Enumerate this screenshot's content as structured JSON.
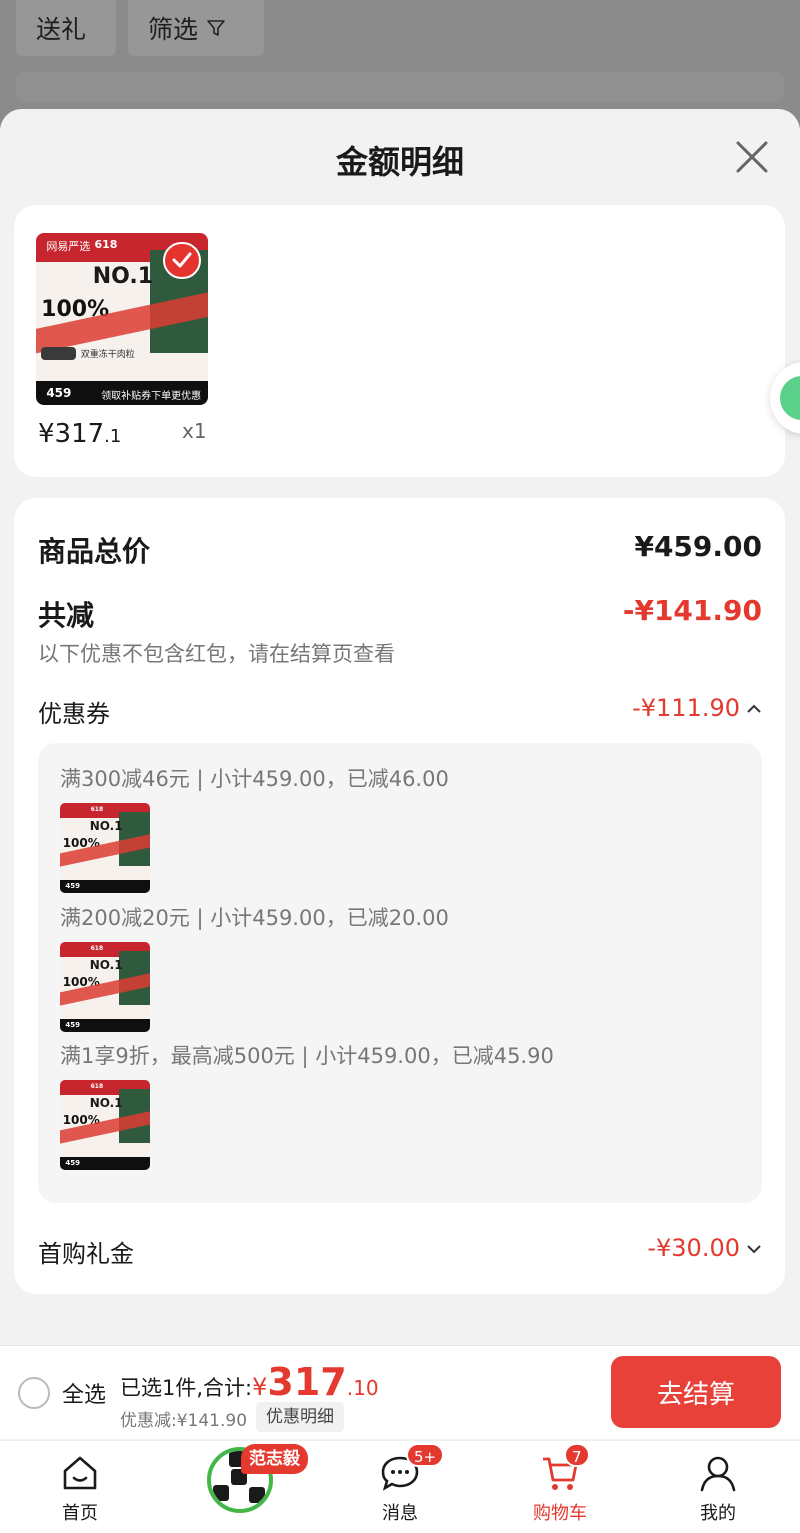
{
  "background": {
    "chip_gift": "送礼",
    "chip_filter": "筛选"
  },
  "sheet": {
    "title": "金额明细"
  },
  "product": {
    "image": {
      "brand": "网易严选",
      "promo_618": "618",
      "no1": "NO.1",
      "pct": "100%",
      "tag": "双重冻干肉粒",
      "price_tag": "459",
      "bottom_text": "领取补贴券下单更优惠"
    },
    "price_int": "¥317",
    "price_dec": ".1",
    "qty": "x1"
  },
  "summary": {
    "total_label": "商品总价",
    "total_value": "¥459.00",
    "minus_label": "共减",
    "minus_value": "-¥141.90",
    "note": "以下优惠不包含红包，请在结算页查看",
    "coupon_label": "优惠券",
    "coupon_value": "-¥111.90",
    "coupons": [
      {
        "text": "满300减46元 | 小计459.00，已减46.00"
      },
      {
        "text": "满200减20元 | 小计459.00，已减20.00"
      },
      {
        "text": "满1享9折，最高减500元 | 小计459.00，已减45.90"
      }
    ],
    "gift_label": "首购礼金",
    "gift_value": "-¥30.00"
  },
  "actionbar": {
    "select_all": "全选",
    "selected_text": "已选1件,合计:",
    "yen": "¥",
    "total_int": "317",
    "total_dec": ".10",
    "discount_text": "优惠减:¥141.90",
    "detail_btn": "优惠明细",
    "checkout": "去结算"
  },
  "tabbar": {
    "items": [
      {
        "label": "首页"
      },
      {
        "label": ""
      },
      {
        "label": "消息",
        "badge": "5+"
      },
      {
        "label": "购物车",
        "badge": "7"
      },
      {
        "label": "我的"
      }
    ],
    "name_tag": "范志毅"
  },
  "colors": {
    "accent_red": "#e3392e",
    "checkout_red": "#e8413a"
  }
}
